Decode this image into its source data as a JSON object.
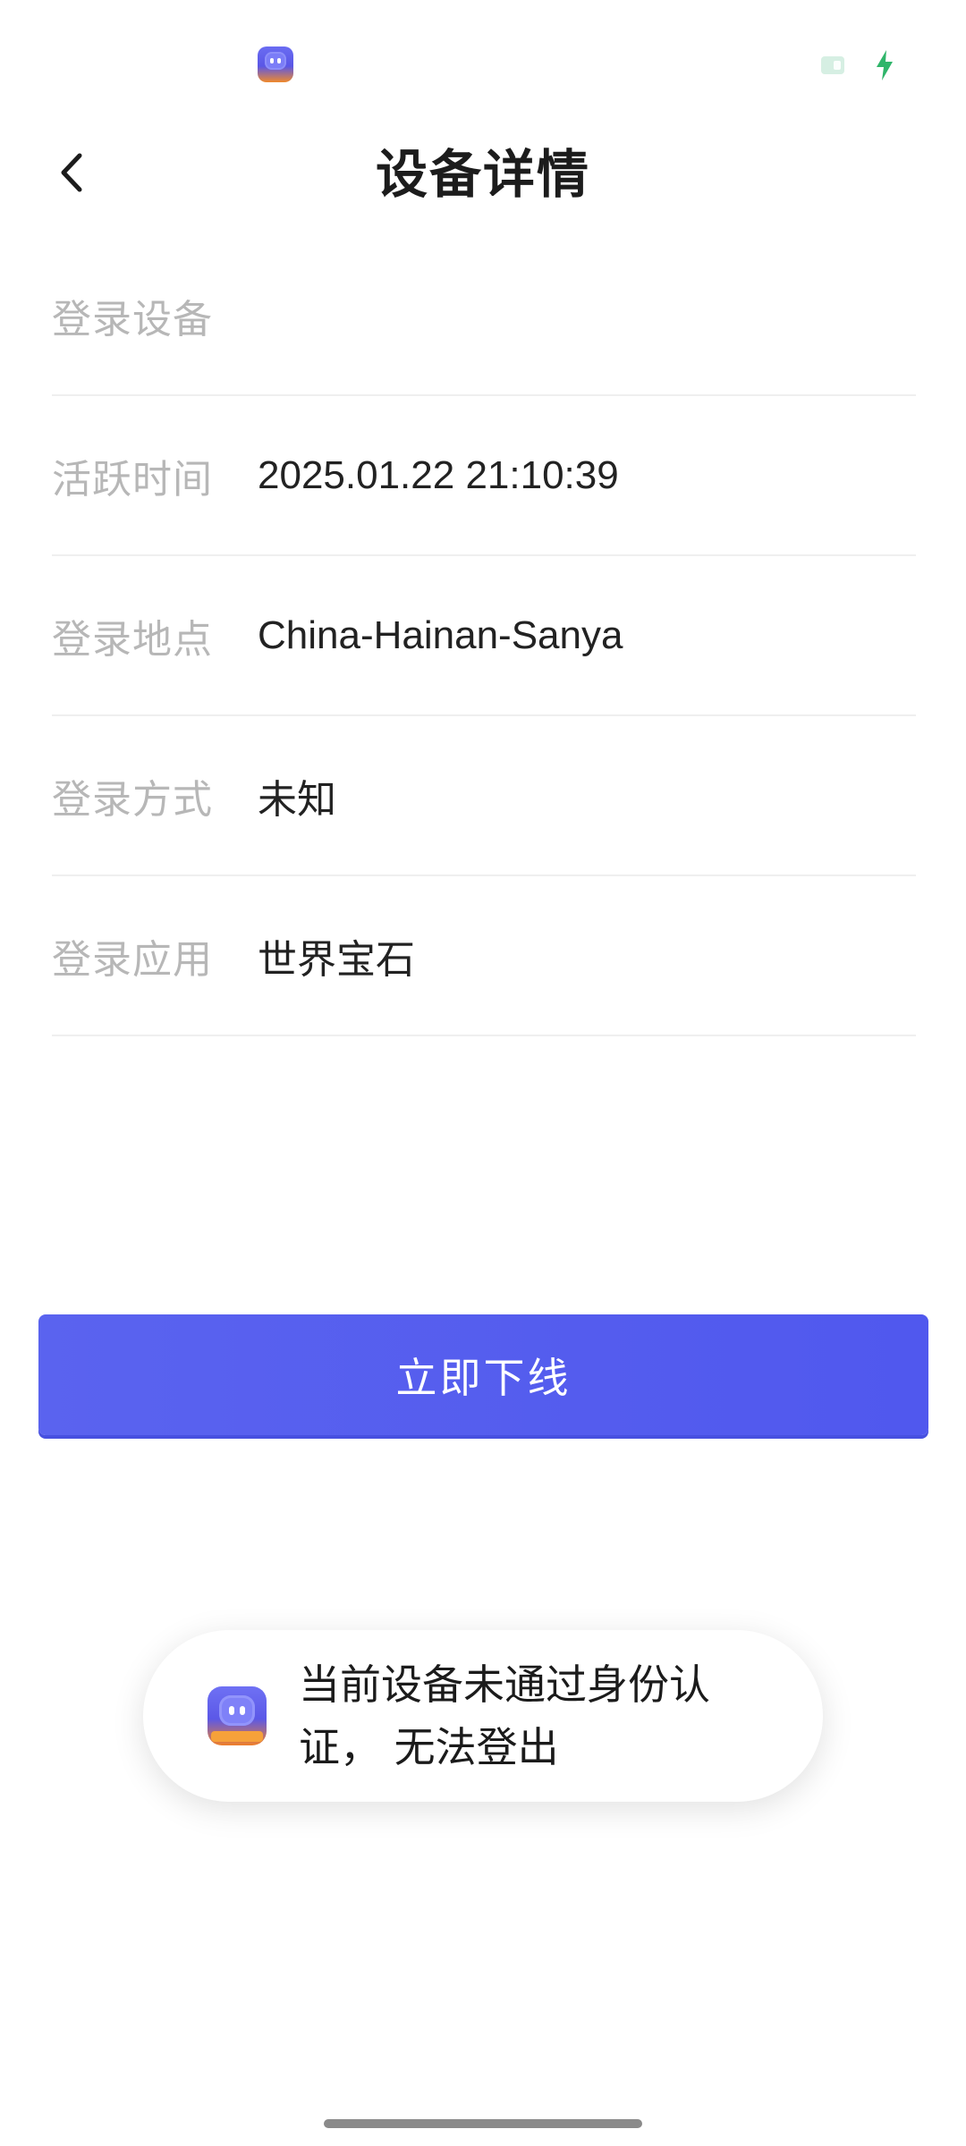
{
  "status_bar": {
    "app_icon": "app-logo-icon",
    "sim_icon": "sim-card-icon",
    "charging_icon": "charging-bolt-icon",
    "charging_color": "#2fb56a"
  },
  "header": {
    "back_icon": "chevron-left-icon",
    "title": "设备详情"
  },
  "details": {
    "rows": [
      {
        "label": "登录设备",
        "value": ""
      },
      {
        "label": "活跃时间",
        "value": "2025.01.22 21:10:39"
      },
      {
        "label": "登录地点",
        "value": "China-Hainan-Sanya"
      },
      {
        "label": "登录方式",
        "value": "未知"
      },
      {
        "label": "登录应用",
        "value": "世界宝石"
      }
    ]
  },
  "actions": {
    "logout_label": "立即下线",
    "accent_color": "#5a62ee"
  },
  "toast": {
    "icon": "app-logo-icon",
    "message": "当前设备未通过身份认证， 无法登出"
  }
}
